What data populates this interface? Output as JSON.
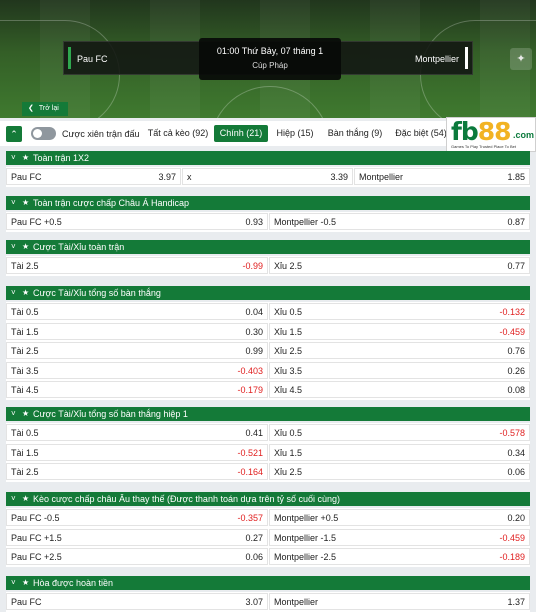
{
  "match": {
    "home": "Pau FC",
    "away": "Montpellier",
    "time": "01:00 Thứ Bảy, 07 tháng 1",
    "league": "Cúp Pháp",
    "back_label": "Trở lại"
  },
  "tabs": {
    "combo_label": "Cược xiên trận đấu",
    "items": [
      {
        "label": "Tất cả kèo (92)",
        "active": false
      },
      {
        "label": "Chính (21)",
        "active": true
      },
      {
        "label": "Hiệp (15)",
        "active": false
      },
      {
        "label": "Bàn thắng (9)",
        "active": false
      },
      {
        "label": "Đặc biệt (54)",
        "active": false
      }
    ]
  },
  "logo": {
    "main": "fb",
    "accent": "88",
    "suffix": ".com",
    "tagline": "Games To Play   Trusted Place To Bet"
  },
  "colors": {
    "brand_green": "#147a38",
    "negative": "#e02020",
    "logo_gold": "#f2b323"
  },
  "sections": [
    {
      "title": "Toàn trận 1X2",
      "cols": 3,
      "rows": [
        [
          {
            "label": "Pau FC",
            "odd": "3.97"
          },
          {
            "label": "x",
            "odd": "3.39"
          },
          {
            "label": "Montpellier",
            "odd": "1.85"
          }
        ]
      ]
    },
    {
      "title": "Toàn trận cược chấp Châu Á Handicap",
      "cols": 2,
      "rows": [
        [
          {
            "label": "Pau FC +0.5",
            "odd": "0.93"
          },
          {
            "label": "Montpellier -0.5",
            "odd": "0.87"
          }
        ]
      ]
    },
    {
      "title": "Cược Tài/Xỉu toàn trận",
      "cols": 2,
      "rows": [
        [
          {
            "label": "Tài 2.5",
            "odd": "-0.99"
          },
          {
            "label": "Xỉu 2.5",
            "odd": "0.77"
          }
        ]
      ]
    },
    {
      "title": "Cược Tài/Xỉu tổng số bàn thắng",
      "cols": 2,
      "rows": [
        [
          {
            "label": "Tài 0.5",
            "odd": "0.04"
          },
          {
            "label": "Xỉu 0.5",
            "odd": "-0.132"
          }
        ],
        [
          {
            "label": "Tài 1.5",
            "odd": "0.30"
          },
          {
            "label": "Xỉu 1.5",
            "odd": "-0.459"
          }
        ],
        [
          {
            "label": "Tài 2.5",
            "odd": "0.99"
          },
          {
            "label": "Xỉu 2.5",
            "odd": "0.76"
          }
        ],
        [
          {
            "label": "Tài 3.5",
            "odd": "-0.403"
          },
          {
            "label": "Xỉu 3.5",
            "odd": "0.26"
          }
        ],
        [
          {
            "label": "Tài 4.5",
            "odd": "-0.179"
          },
          {
            "label": "Xỉu 4.5",
            "odd": "0.08"
          }
        ]
      ]
    },
    {
      "title": "Cược Tài/Xỉu tổng số bàn thắng hiệp 1",
      "cols": 2,
      "rows": [
        [
          {
            "label": "Tài 0.5",
            "odd": "0.41"
          },
          {
            "label": "Xỉu 0.5",
            "odd": "-0.578"
          }
        ],
        [
          {
            "label": "Tài 1.5",
            "odd": "-0.521"
          },
          {
            "label": "Xỉu 1.5",
            "odd": "0.34"
          }
        ],
        [
          {
            "label": "Tài 2.5",
            "odd": "-0.164"
          },
          {
            "label": "Xỉu 2.5",
            "odd": "0.06"
          }
        ]
      ]
    },
    {
      "title": "Kèo cược chấp châu Âu thay thế (Được thanh toán dựa trên tỷ số cuối cùng)",
      "cols": 2,
      "rows": [
        [
          {
            "label": "Pau FC -0.5",
            "odd": "-0.357"
          },
          {
            "label": "Montpellier +0.5",
            "odd": "0.20"
          }
        ],
        [
          {
            "label": "Pau FC +1.5",
            "odd": "0.27"
          },
          {
            "label": "Montpellier -1.5",
            "odd": "-0.459"
          }
        ],
        [
          {
            "label": "Pau FC +2.5",
            "odd": "0.06"
          },
          {
            "label": "Montpellier -2.5",
            "odd": "-0.189"
          }
        ]
      ]
    },
    {
      "title": "Hòa được hoàn tiền",
      "cols": 2,
      "rows": [
        [
          {
            "label": "Pau FC",
            "odd": "3.07"
          },
          {
            "label": "Montpellier",
            "odd": "1.37"
          }
        ]
      ]
    }
  ]
}
